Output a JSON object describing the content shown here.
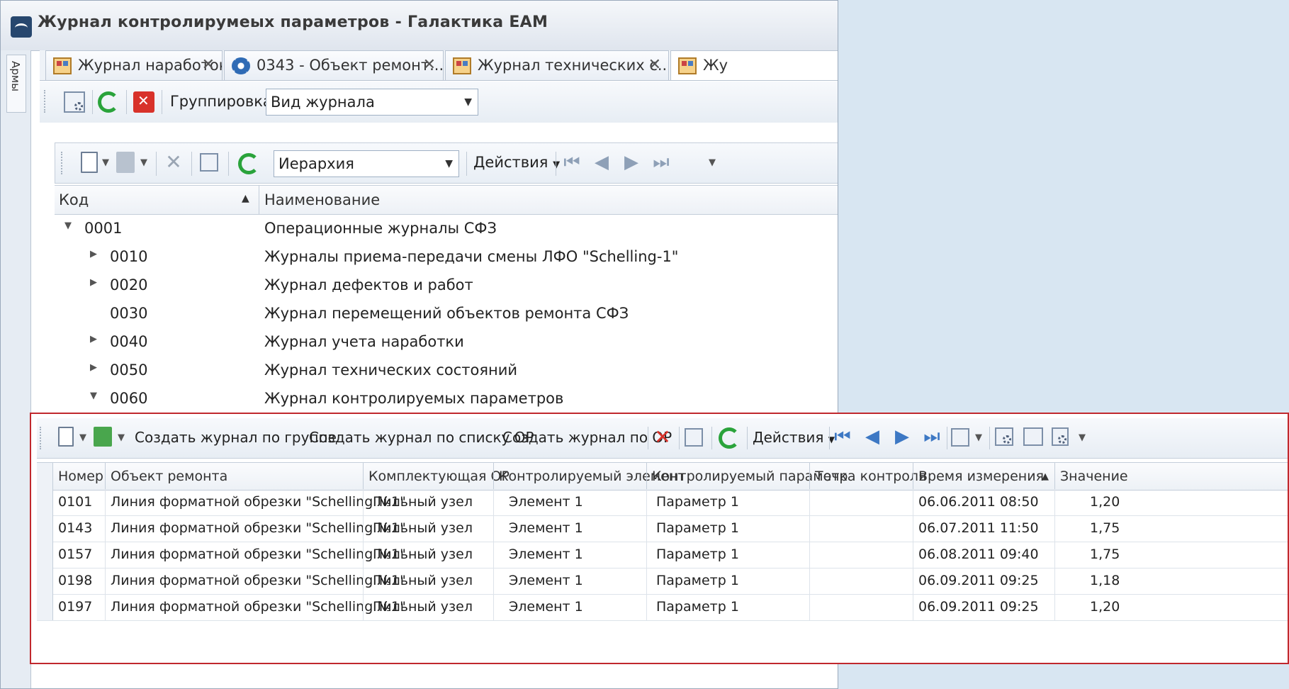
{
  "window": {
    "title": "Журнал контролирумеых параметров - Галактика ЕАМ"
  },
  "side_panel": {
    "label": "Армы"
  },
  "doc_tabs": [
    {
      "label": "Журнал наработок",
      "icon": "journal-icon"
    },
    {
      "label": "0343 - Объект ремонт...",
      "icon": "gear-icon"
    },
    {
      "label": "Журнал технических с...",
      "icon": "journal-icon"
    },
    {
      "label": "Жу",
      "icon": "journal-icon"
    }
  ],
  "toolbar1": {
    "grouping_label": "Группировка",
    "grouping_value": "Вид журнала"
  },
  "toolbar2": {
    "view_value": "Иерархия",
    "actions_label": "Действия"
  },
  "tree": {
    "columns": {
      "code": "Код",
      "name": "Наименование"
    },
    "rows": [
      {
        "code": "0001",
        "name": "Операционные журналы СФЗ",
        "level": 0,
        "expander": "expanded"
      },
      {
        "code": "0010",
        "name": "Журналы приема-передачи смены ЛФО \"Schelling-1\"",
        "level": 1,
        "expander": "collapsed"
      },
      {
        "code": "0020",
        "name": "Журнал дефектов  и работ",
        "level": 1,
        "expander": "collapsed"
      },
      {
        "code": "0030",
        "name": "Журнал перемещений объектов ремонта СФЗ",
        "level": 1,
        "expander": "none"
      },
      {
        "code": "0040",
        "name": "Журнал учета наработки",
        "level": 1,
        "expander": "collapsed"
      },
      {
        "code": "0050",
        "name": "Журнал технических состояний",
        "level": 1,
        "expander": "collapsed"
      },
      {
        "code": "0060",
        "name": "Журнал контролируемых параметров",
        "level": 1,
        "expander": "expanded"
      }
    ]
  },
  "toolbar3": {
    "create_by_group": "Создать журнал по группе",
    "create_by_list": "Создать журнал по списку ОР",
    "create_by_or": "Создать журнал по ОР",
    "actions_label": "Действия"
  },
  "grid": {
    "columns": [
      "Номер",
      "Объект ремонта",
      "Комплектующая ОР",
      "Контролируемый элемент",
      "Контролируемый параметр",
      "Точка контроля",
      "Время измерения",
      "Значение"
    ],
    "rows": [
      {
        "num": "0101",
        "object": "Линия форматной обрезки \"Schelling №1\"",
        "component": "Пильный узел",
        "element": "Элемент 1",
        "param": "Параметр 1",
        "point": "",
        "time": "06.06.2011 08:50",
        "value": "1,20"
      },
      {
        "num": "0143",
        "object": "Линия форматной обрезки \"Schelling №1\"",
        "component": "Пильный узел",
        "element": "Элемент 1",
        "param": "Параметр 1",
        "point": "",
        "time": "06.07.2011 11:50",
        "value": "1,75"
      },
      {
        "num": "0157",
        "object": "Линия форматной обрезки \"Schelling №1\"",
        "component": "Пильный узел",
        "element": "Элемент 1",
        "param": "Параметр 1",
        "point": "",
        "time": "06.08.2011 09:40",
        "value": "1,75"
      },
      {
        "num": "0198",
        "object": "Линия форматной обрезки \"Schelling №1\"",
        "component": "Пильный узел",
        "element": "Элемент 1",
        "param": "Параметр 1",
        "point": "",
        "time": "06.09.2011 09:25",
        "value": "1,18"
      },
      {
        "num": "0197",
        "object": "Линия форматной обрезки \"Schelling №1\"",
        "component": "Пильный узел",
        "element": "Элемент 1",
        "param": "Параметр 1",
        "point": "",
        "time": "06.09.2011 09:25",
        "value": "1,20"
      }
    ]
  },
  "colors": {
    "highlight_border": "#c0282d",
    "refresh_green": "#2aa33b",
    "delete_red": "#d8322a"
  }
}
